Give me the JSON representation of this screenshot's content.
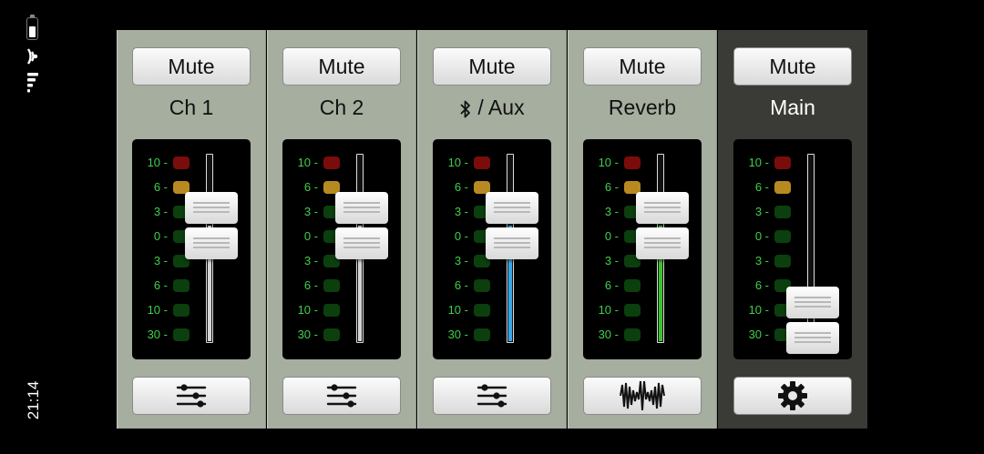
{
  "status": {
    "time": "21:14",
    "battery_icon": "battery-icon",
    "wifi_icon": "wifi-icon",
    "signal_icon": "cellular-signal-icon"
  },
  "scale_labels": [
    "10",
    "6",
    "3",
    "0",
    "3",
    "6",
    "10",
    "30"
  ],
  "led_colors": [
    "red",
    "amber",
    "green",
    "green",
    "green",
    "green",
    "green",
    "green"
  ],
  "colors": {
    "strip_bg": "#a5ae9f",
    "master_bg": "#3a3a37",
    "meter_label": "#3ecf4a",
    "aux_fill": "#36a6e6",
    "reverb_fill": "#3cc42f",
    "default_fill": "#d4d4d4"
  },
  "channels": [
    {
      "mute_label": "Mute",
      "label": "Ch 1",
      "fader_level": 0.62,
      "fill_color": "#d4d4d4",
      "bottom_icon": "eq-sliders-icon"
    },
    {
      "mute_label": "Mute",
      "label": "Ch 2",
      "fader_level": 0.62,
      "fill_color": "#d4d4d4",
      "bottom_icon": "eq-sliders-icon"
    },
    {
      "mute_label": "Mute",
      "label": "/ Aux",
      "label_icon": "bluetooth-icon",
      "fader_level": 0.62,
      "fill_color": "#36a6e6",
      "bottom_icon": "eq-sliders-icon"
    },
    {
      "mute_label": "Mute",
      "label": "Reverb",
      "fader_level": 0.62,
      "fill_color": "#3cc42f",
      "bottom_icon": "reverb-waveform-icon"
    }
  ],
  "master": {
    "mute_label": "Mute",
    "label": "Main",
    "fader_level": 0.12,
    "bottom_icon": "gear-icon"
  }
}
